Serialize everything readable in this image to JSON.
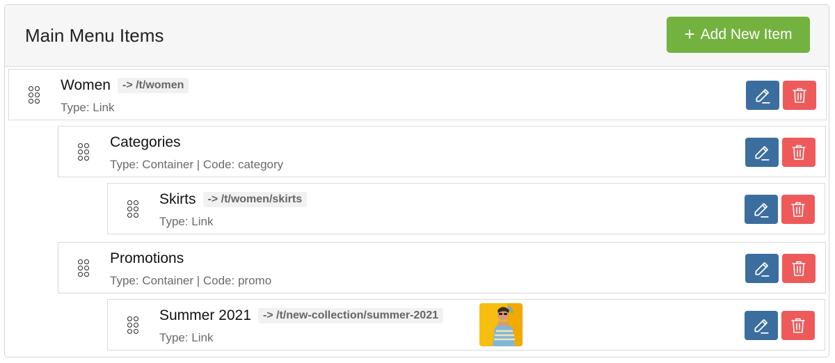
{
  "header": {
    "title": "Main Menu Items",
    "add_button_label": "Add New Item",
    "add_button_icon": "plus-icon"
  },
  "colors": {
    "add_button": "#74b23f",
    "edit_button": "#3b6e9e",
    "delete_button": "#ee5a5a"
  },
  "items": [
    {
      "name": "Women",
      "path": "-> /t/women",
      "type": "Type: Link",
      "level": 0
    },
    {
      "name": "Categories",
      "path": "",
      "type": "Type: Container | Code: category",
      "level": 1
    },
    {
      "name": "Skirts",
      "path": "-> /t/women/skirts",
      "type": "Type: Link",
      "level": 2
    },
    {
      "name": "Promotions",
      "path": "",
      "type": "Type: Container | Code: promo",
      "level": 1
    },
    {
      "name": "Summer 2021",
      "path": "-> /t/new-collection/summer-2021",
      "type": "Type: Link",
      "level": 2,
      "has_image": true
    }
  ]
}
